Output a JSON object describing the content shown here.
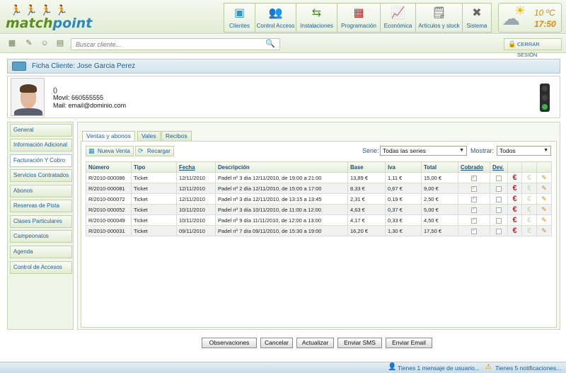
{
  "app": {
    "logo_text_a": "match",
    "logo_text_b": "point"
  },
  "nav": [
    {
      "label": "Clientes",
      "icon": "clients-card-icon"
    },
    {
      "label": "Control Acceso",
      "icon": "access-control-people-icon"
    },
    {
      "label": "Instalaciones",
      "icon": "signpost-icon"
    },
    {
      "label": "Programación",
      "icon": "calendar-icon"
    },
    {
      "label": "Económica",
      "icon": "chart-icon"
    },
    {
      "label": "Artículos y stock",
      "icon": "document-list-icon"
    },
    {
      "label": "Sistema",
      "icon": "tools-icon"
    }
  ],
  "weather": {
    "temp": "10 ºC",
    "time": "17:50"
  },
  "toolbar": {
    "search_placeholder": "Buscar cliente...",
    "logout_label": "CERRAR SESIÓN"
  },
  "ficha": {
    "title": "Ficha Cliente: Jose Garcia Perez"
  },
  "client": {
    "line1": "()",
    "phone": "Movil: 660555555",
    "mail": "Mail: email@dominio.com"
  },
  "sidebar": {
    "items": [
      {
        "label": "General"
      },
      {
        "label": "Información Adicional"
      },
      {
        "label": "Facturación Y Cobro"
      },
      {
        "label": "Servicios Contratados"
      },
      {
        "label": "Abonos"
      },
      {
        "label": "Reservas de Pista"
      },
      {
        "label": "Clases Particulares"
      },
      {
        "label": "Campeonatos"
      },
      {
        "label": "Agenda"
      },
      {
        "label": "Control de Accesos"
      }
    ]
  },
  "tabs": [
    {
      "label": "Ventas y abonos"
    },
    {
      "label": "Vales"
    },
    {
      "label": "Recibos"
    }
  ],
  "actions": {
    "new_sale": "Nueva Venta",
    "reload": "Recargar"
  },
  "filters": {
    "serie_label": "Serie:",
    "serie_value": "Todas las series",
    "show_label": "Mostrar:",
    "show_value": "Todos"
  },
  "table": {
    "headers": [
      "Número",
      "Tipo",
      "Fecha",
      "Descripción",
      "Base",
      "Iva",
      "Total",
      "Cobrado",
      "Dev."
    ],
    "rows": [
      {
        "numero": "R/2010-000086",
        "tipo": "Ticket",
        "fecha": "12/11/2010",
        "desc": "Padel nº 3 día 12/11/2010, de 19:00 a 21:00",
        "base": "13,89 €",
        "iva": "1,11 €",
        "total": "15,00 €",
        "cobrado": true,
        "dev": false
      },
      {
        "numero": "R/2010-000081",
        "tipo": "Ticket",
        "fecha": "12/11/2010",
        "desc": "Padel nº 2 día 12/11/2010, de 15:00 a 17:00",
        "base": "8,33 €",
        "iva": "0,67 €",
        "total": "9,00 €",
        "cobrado": true,
        "dev": false
      },
      {
        "numero": "R/2010-000072",
        "tipo": "Ticket",
        "fecha": "12/11/2010",
        "desc": "Padel nº 3 día 12/11/2010, de 13:15 a 13:45",
        "base": "2,31 €",
        "iva": "0,19 €",
        "total": "2,50 €",
        "cobrado": true,
        "dev": false
      },
      {
        "numero": "R/2010-000052",
        "tipo": "Ticket",
        "fecha": "10/11/2010",
        "desc": "Padel nº 3 día 10/11/2010, de 11:00 a 12:00",
        "base": "4,63 €",
        "iva": "0,37 €",
        "total": "5,00 €",
        "cobrado": true,
        "dev": false
      },
      {
        "numero": "R/2010-000049",
        "tipo": "Ticket",
        "fecha": "10/11/2010",
        "desc": "Padel nº 9 día 11/11/2010, de 12:00 a 13:00",
        "base": "4,17 €",
        "iva": "0,33 €",
        "total": "4,50 €",
        "cobrado": true,
        "dev": false
      },
      {
        "numero": "R/2010-000031",
        "tipo": "Ticket",
        "fecha": "09/11/2010",
        "desc": "Padel nº 7 día 09/11/2010, de 15:30 a 19:00",
        "base": "16,20 €",
        "iva": "1,30 €",
        "total": "17,50 €",
        "cobrado": true,
        "dev": false
      }
    ]
  },
  "buttons": {
    "observaciones": "Observaciones",
    "cancelar": "Cancelar",
    "actualizar": "Actualizar",
    "sms": "Enviar SMS",
    "email": "Enviar Email"
  },
  "footer": {
    "messages": "Tienes 1 mensaje de usuario...",
    "notifications": "Tienes 5 notificaciones..."
  }
}
